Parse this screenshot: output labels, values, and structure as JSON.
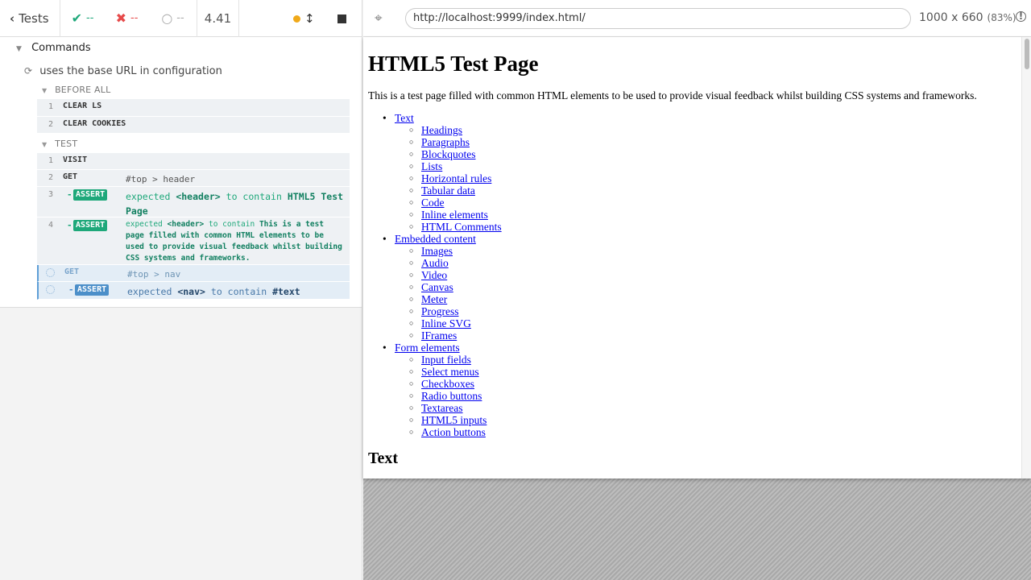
{
  "reporter": {
    "back_label": "Tests",
    "passed": "--",
    "failed": "--",
    "pending": "--",
    "duration": "4.41",
    "commands_title": "Commands",
    "test_title": "uses the base URL in configuration",
    "before_all_label": "BEFORE ALL",
    "test_label": "TEST",
    "before_all": [
      {
        "num": "1",
        "name": "CLEAR LS"
      },
      {
        "num": "2",
        "name": "CLEAR COOKIES"
      }
    ],
    "test_cmds": {
      "visit": {
        "num": "1",
        "name": "VISIT"
      },
      "get1": {
        "num": "2",
        "name": "GET",
        "msg": "#top > header"
      },
      "assert1": {
        "num": "3",
        "badge": "ASSERT",
        "pre": "expected",
        "subject": "<header>",
        "mid": "to contain",
        "value": "HTML5 Test Page"
      },
      "assert2": {
        "num": "4",
        "badge": "ASSERT",
        "pre": "expected",
        "subject": "<header>",
        "mid": "to contain",
        "value": "This is a test page filled with common HTML elements to be used to provide visual feedback whilst building CSS systems and frameworks."
      },
      "get2": {
        "name": "GET",
        "msg": "#top > nav"
      },
      "assert3": {
        "badge": "ASSERT",
        "pre": "expected",
        "subject": "<nav>",
        "mid": "to contain",
        "value": "#text"
      }
    }
  },
  "aut": {
    "url": "http://localhost:9999/index.html/",
    "viewport_size": "1000 x 660",
    "viewport_scale": "(83%)",
    "page": {
      "h1": "HTML5 Test Page",
      "intro": "This is a test page filled with common HTML elements to be used to provide visual feedback whilst building CSS systems and frameworks.",
      "h2": "Text",
      "toc": [
        {
          "label": "Text",
          "children": [
            "Headings",
            "Paragraphs",
            "Blockquotes",
            "Lists",
            "Horizontal rules",
            "Tabular data",
            "Code",
            "Inline elements",
            "HTML Comments"
          ]
        },
        {
          "label": "Embedded content",
          "children": [
            "Images",
            "Audio",
            "Video",
            "Canvas",
            "Meter",
            "Progress",
            "Inline SVG",
            "IFrames"
          ]
        },
        {
          "label": "Form elements",
          "children": [
            "Input fields",
            "Select menus",
            "Checkboxes",
            "Radio buttons",
            "Textareas",
            "HTML5 inputs",
            "Action buttons"
          ]
        }
      ]
    }
  },
  "colors": {
    "pass": "#1ea87a",
    "fail": "#e64a4a",
    "running": "#f0a91a",
    "link": "#0000ee"
  }
}
